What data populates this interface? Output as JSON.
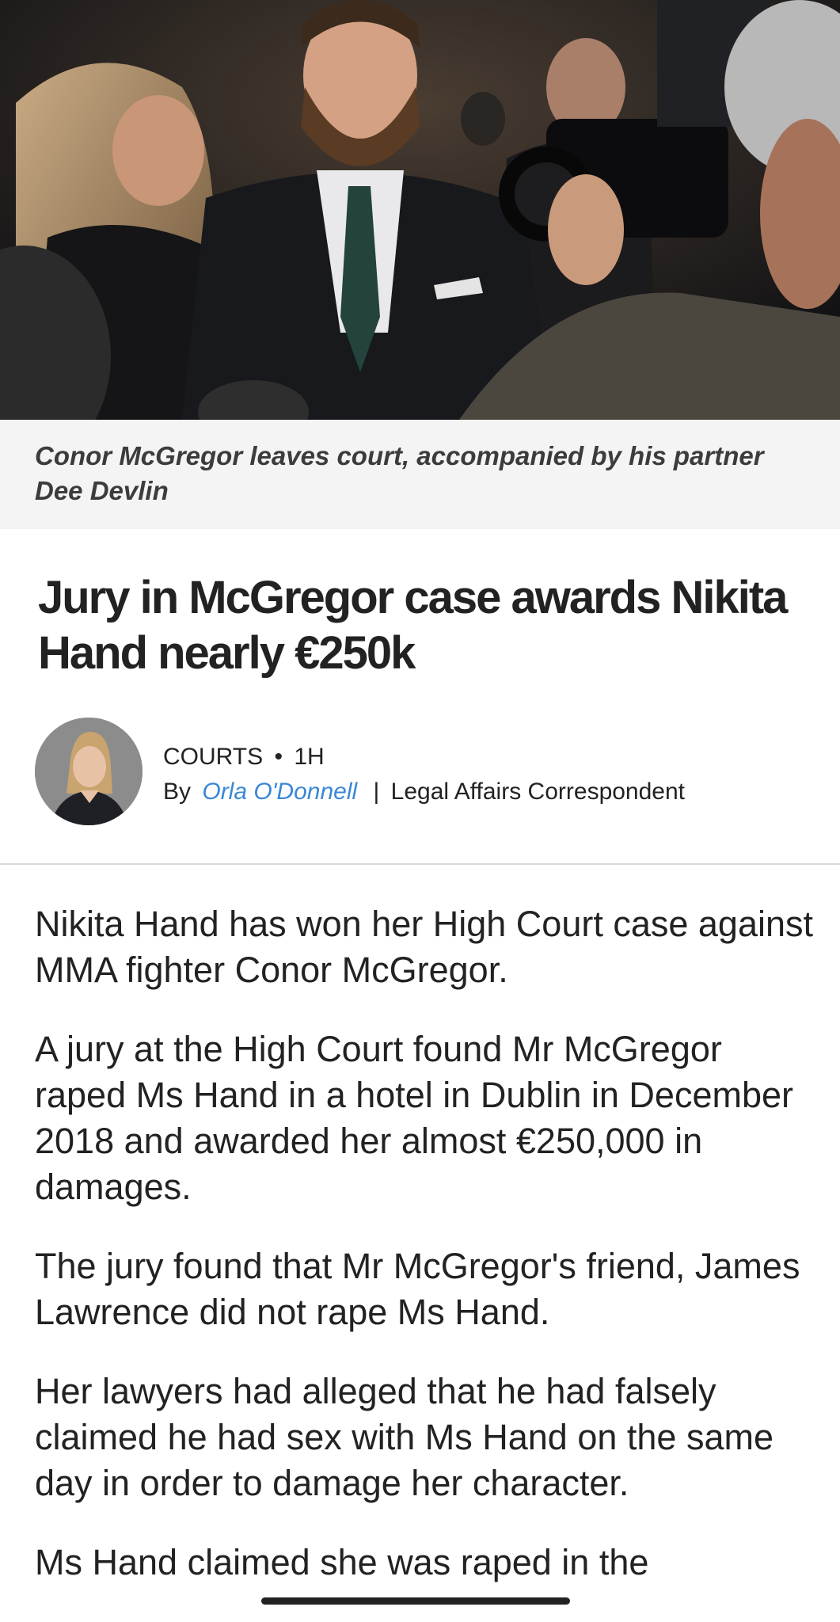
{
  "hero": {
    "caption": "Conor McGregor leaves court, accompanied by his partner Dee Devlin"
  },
  "article": {
    "headline": "Jury in McGregor case awards Nikita Hand nearly €250k",
    "category": "COURTS",
    "separator": "•",
    "time_ago": "1H",
    "by_prefix": "By",
    "author": "Orla O'Donnell",
    "role_separator": "|",
    "author_role": "Legal Affairs Correspondent",
    "paragraphs": [
      "Nikita Hand has won her High Court case against MMA fighter Conor McGregor.",
      "A jury at the High Court found Mr McGregor raped Ms Hand in a hotel in Dublin in December 2018 and awarded her almost €250,000 in damages.",
      "The jury found that Mr McGregor's friend, James Lawrence did not rape Ms Hand.",
      "Her lawyers had alleged that he had falsely claimed he had sex with Ms Hand on the same day in order to damage her character.",
      "Ms Hand claimed she was raped in the"
    ]
  },
  "colors": {
    "author_link": "#3b87d6",
    "caption_background": "#f4f4f4",
    "text": "#222222"
  }
}
